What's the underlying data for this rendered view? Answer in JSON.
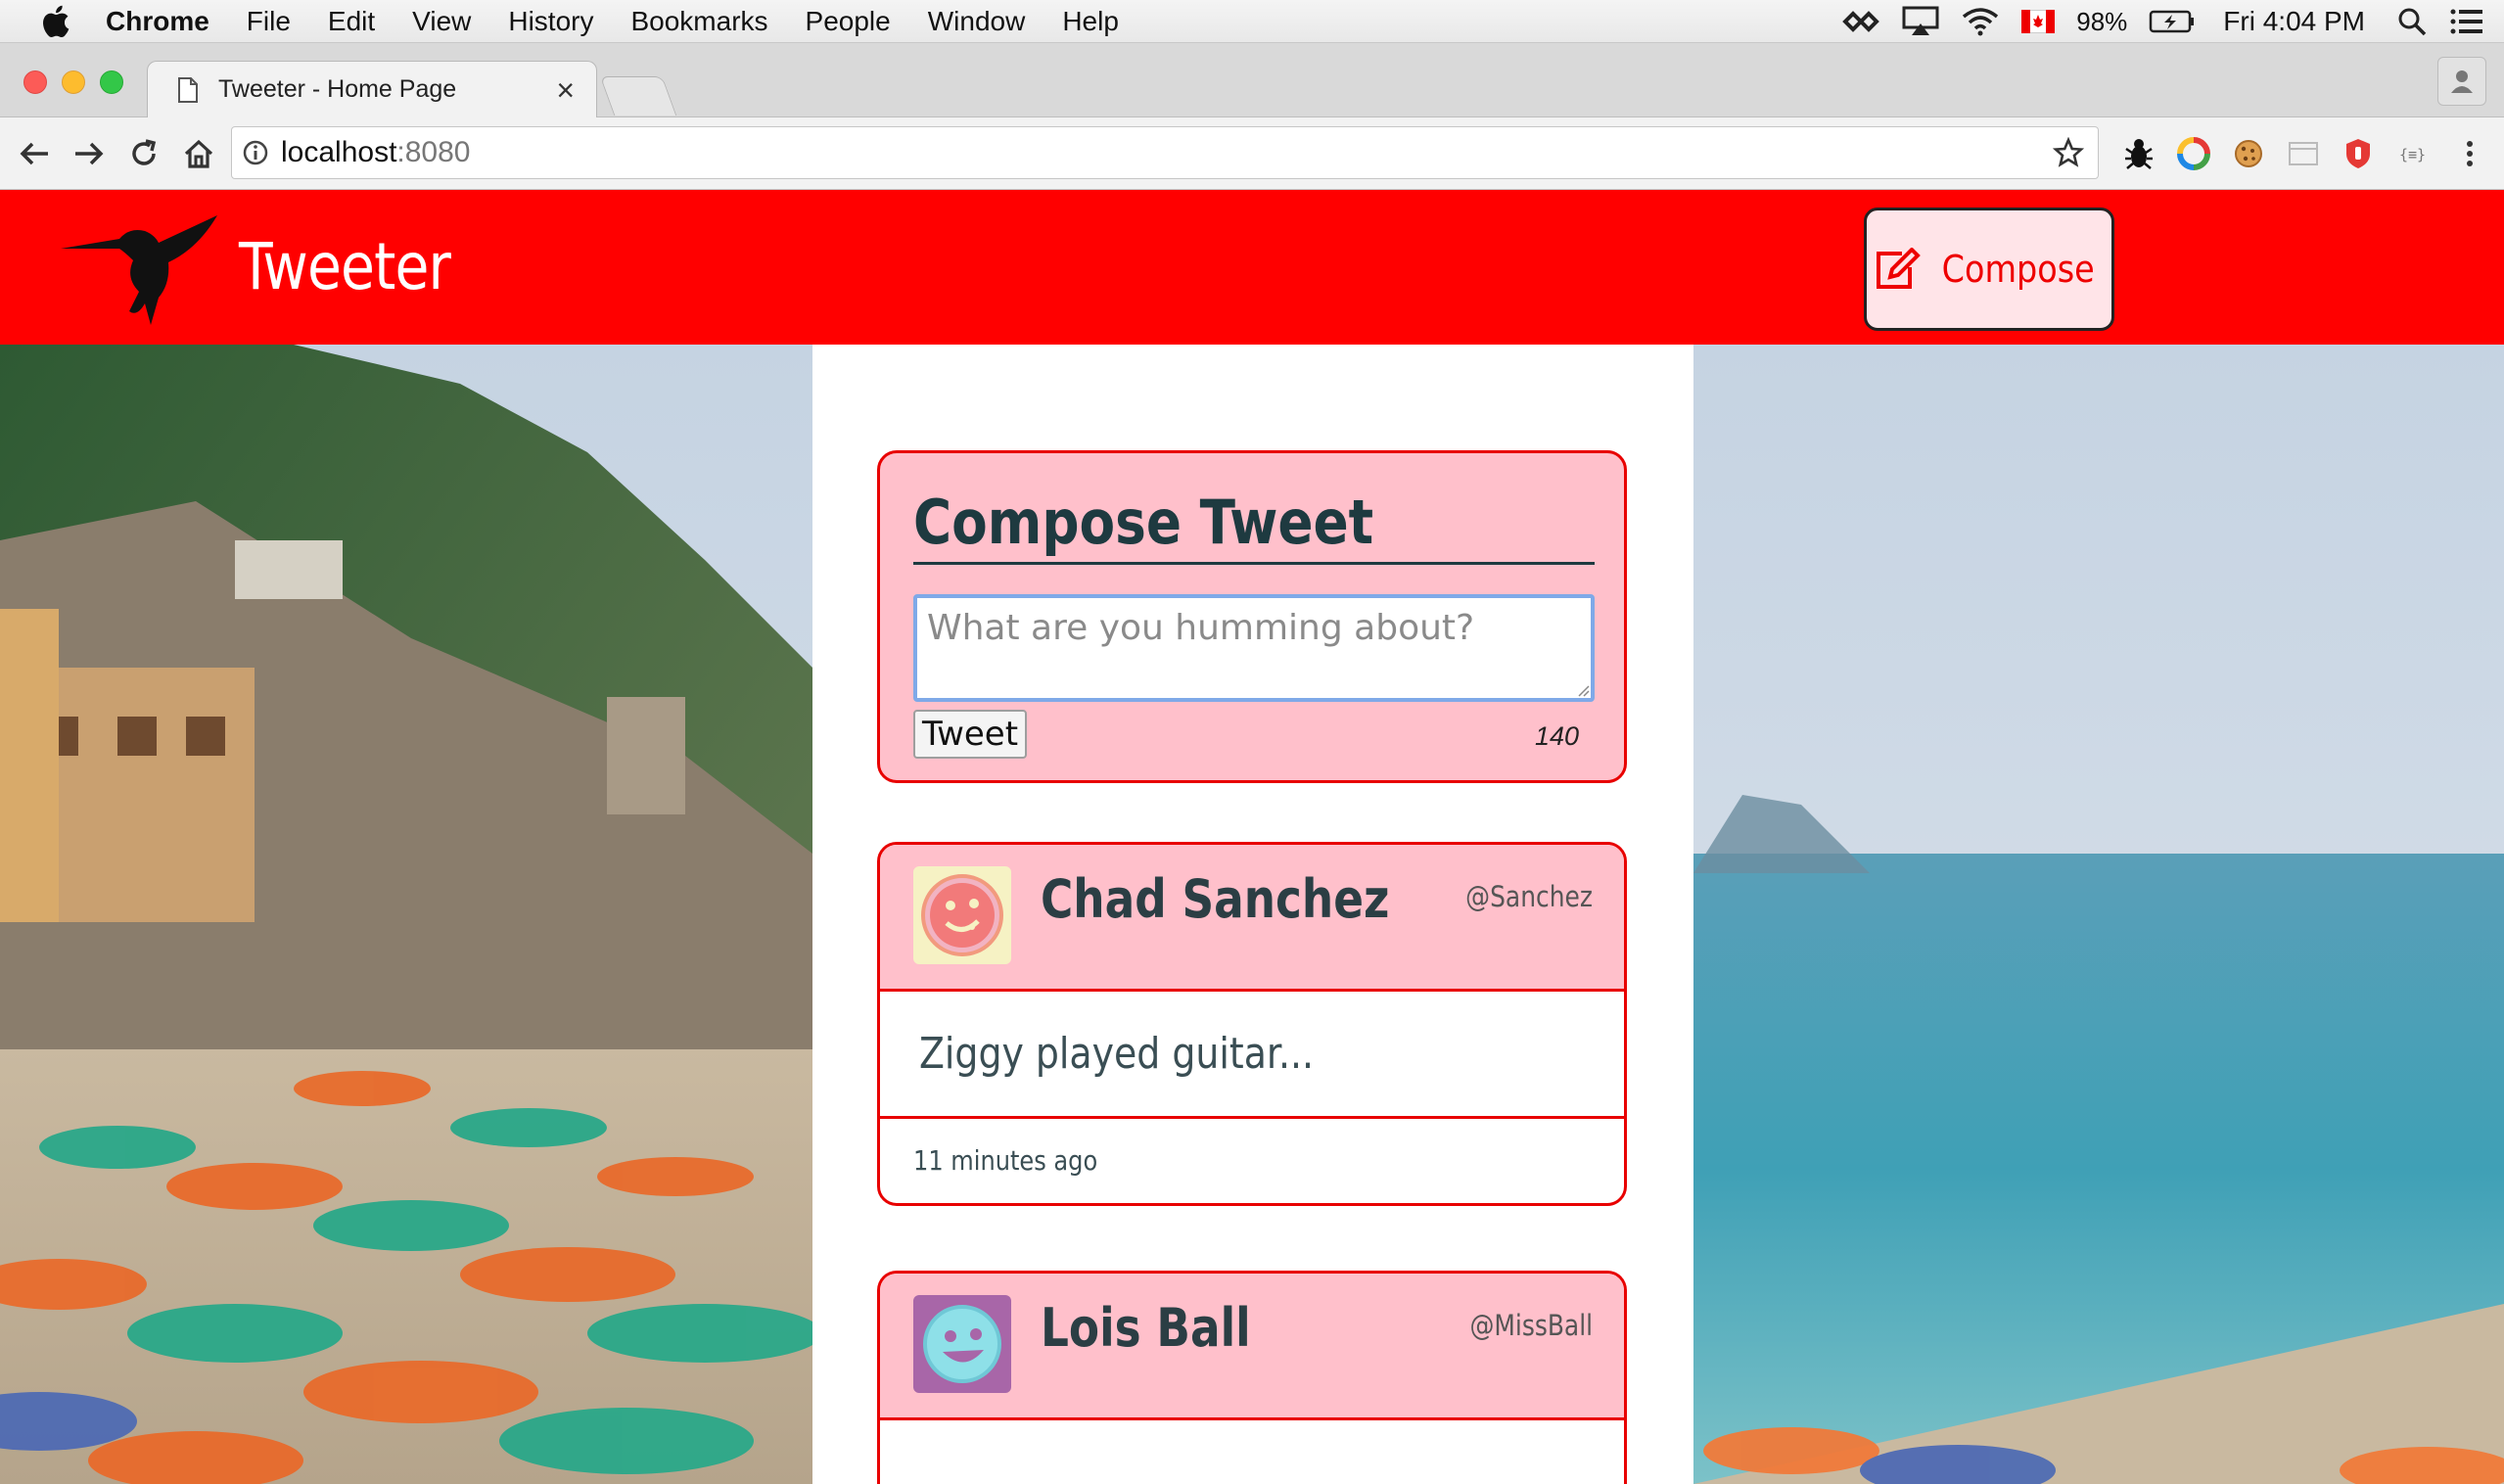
{
  "menubar": {
    "app_name": "Chrome",
    "items": [
      "File",
      "Edit",
      "View",
      "History",
      "Bookmarks",
      "People",
      "Window",
      "Help"
    ],
    "battery": "98%",
    "clock": "Fri 4:04 PM"
  },
  "browser": {
    "tab_title": "Tweeter - Home Page",
    "url_host": "localhost",
    "url_port": ":8080"
  },
  "site": {
    "brand": "Tweeter",
    "compose_button": "Compose",
    "accent_color": "#ff0000",
    "card_color": "#ffc0cb"
  },
  "composer": {
    "heading": "Compose Tweet",
    "placeholder": "What are you humming about?",
    "submit_label": "Tweet",
    "counter": "140"
  },
  "tweets": [
    {
      "name": "Chad Sanchez",
      "handle": "@Sanchez",
      "text": "Ziggy played guitar...",
      "time": "11 minutes ago",
      "avatar_icon": "pizza-face-avatar"
    },
    {
      "name": "Lois Ball",
      "handle": "@MissBall",
      "text": "",
      "time": "",
      "avatar_icon": "smiley-face-avatar"
    }
  ]
}
